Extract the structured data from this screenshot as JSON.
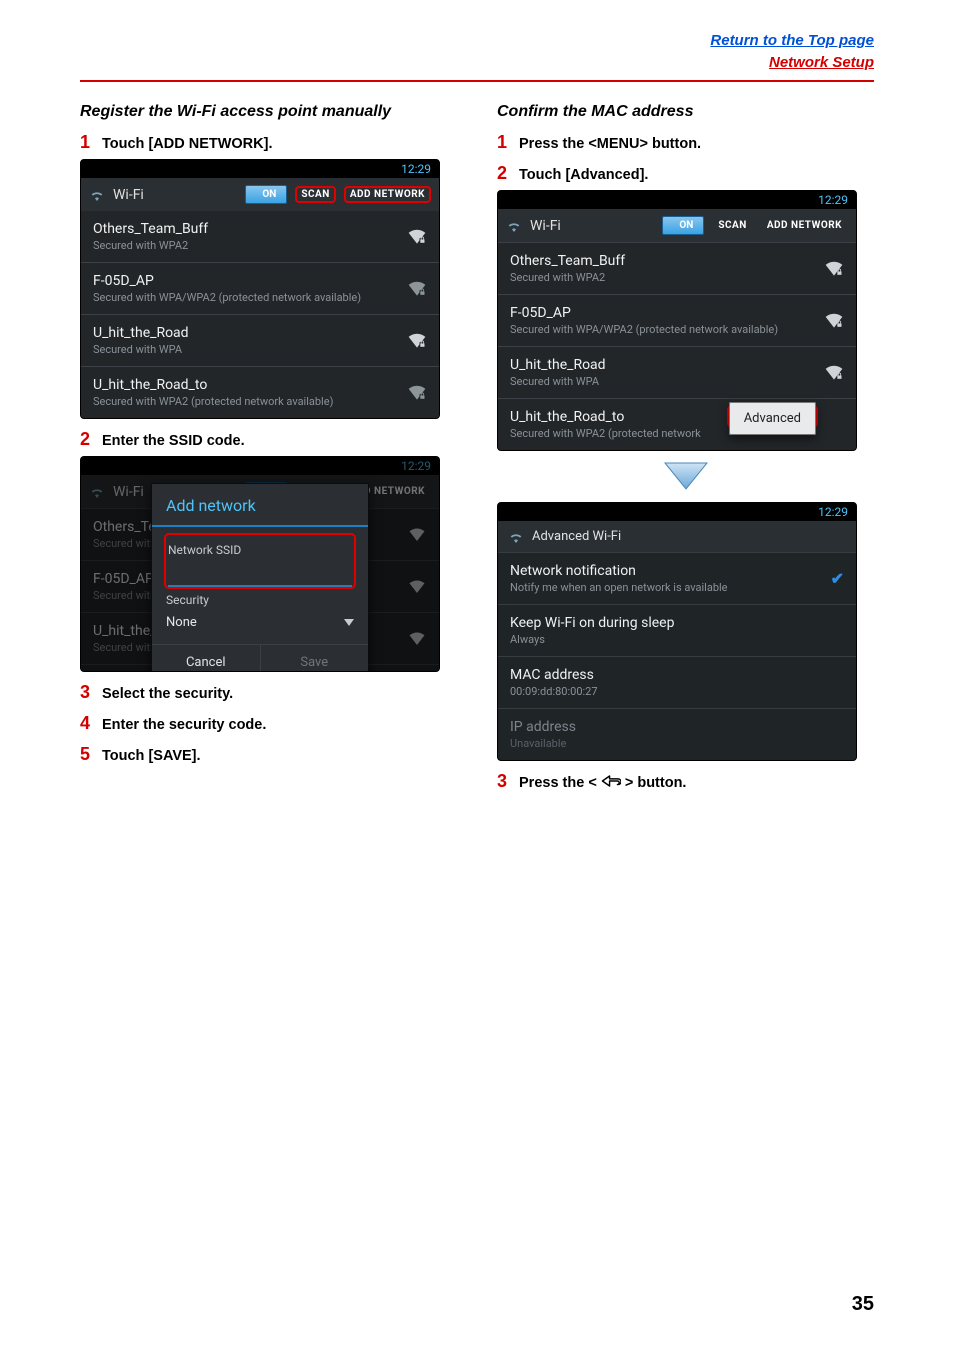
{
  "header": {
    "top_link": "Return to the Top page",
    "network_link": "Network Setup"
  },
  "left": {
    "section_title": "Register the Wi-Fi access point manually",
    "step1": "Touch [ADD NETWORK].",
    "step2": "Enter the SSID code.",
    "step3": "Select the security.",
    "step4": "Enter the security code.",
    "step5": "Touch [SAVE]."
  },
  "right": {
    "section_title": "Confirm the MAC address",
    "step1": "Press the <MENU> button.",
    "step2": "Touch [Advanced].",
    "step3_pre": "Press the < ",
    "step3_post": " > button."
  },
  "shot_common": {
    "clock": "12:29",
    "wifi_title": "Wi-Fi",
    "toggle_on": "ON",
    "scan": "SCAN",
    "add_net": "ADD NETWORK"
  },
  "networks": [
    {
      "ssid": "Others_Team_Buff",
      "sub": "Secured with WPA2",
      "lock": true
    },
    {
      "ssid": "F-05D_AP",
      "sub": "Secured with WPA/WPA2 (protected network available)",
      "lock": true
    },
    {
      "ssid": "U_hit_the_Road",
      "sub": "Secured with WPA",
      "lock": true
    },
    {
      "ssid": "U_hit_the_Road_to",
      "sub": "Secured with WPA2 (protected network available)",
      "lock": true
    }
  ],
  "networks_right4_sub": "Secured with WPA2 (protected network",
  "modal": {
    "title": "Add network",
    "ssid_label": "Network SSID",
    "security_label": "Security",
    "security_value": "None",
    "cancel": "Cancel",
    "save": "Save"
  },
  "menu_popup": "Advanced",
  "advanced": {
    "header": "Advanced Wi-Fi",
    "rows": [
      {
        "t": "Network notification",
        "s": "Notify me when an open network is available",
        "check": true
      },
      {
        "t": "Keep Wi-Fi on during sleep",
        "s": "Always"
      },
      {
        "t": "MAC address",
        "s": "00:09:dd:80:00:27"
      },
      {
        "t": "IP address",
        "s": "Unavailable",
        "muted": true
      }
    ]
  },
  "page_number": "35"
}
